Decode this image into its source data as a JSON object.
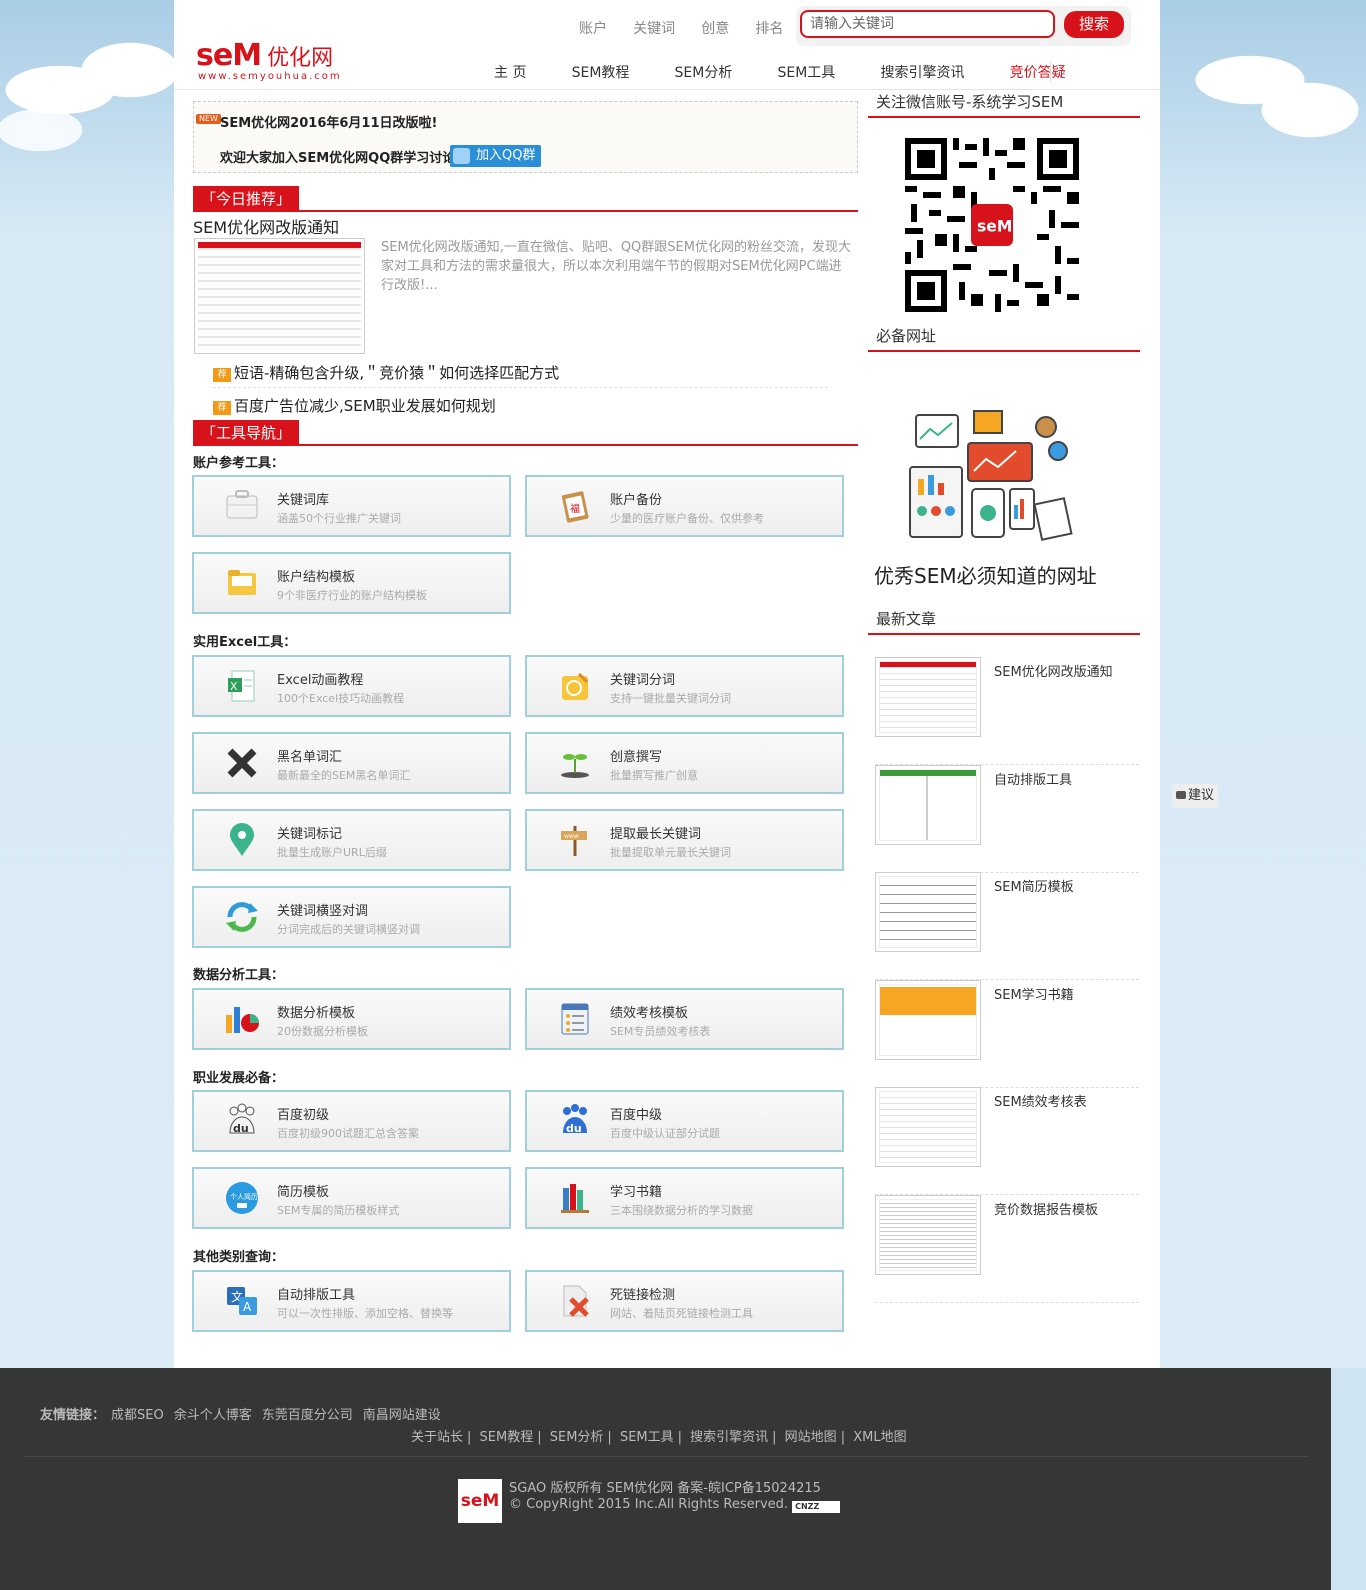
{
  "header": {
    "logo_text": "seM",
    "logo_cn": "优化网",
    "logo_url": "www.semyouhua.com",
    "top_links": [
      "账户",
      "关键词",
      "创意",
      "排名"
    ],
    "search_placeholder": "请输入关键词",
    "search_button": "搜索",
    "nav": [
      "主 页",
      "SEM教程",
      "SEM分析",
      "SEM工具",
      "搜索引擎资讯",
      "竞价答疑"
    ]
  },
  "notice": {
    "badge": "NEW",
    "title": "SEM优化网2016年6月11日改版啦!",
    "subtitle": "欢迎大家加入SEM优化网QQ群学习讨论",
    "qq_button": "加入QQ群"
  },
  "today": {
    "heading": "「今日推荐」",
    "title": "SEM优化网改版通知",
    "desc": "SEM优化网改版通知,一直在微信、贴吧、QQ群跟SEM优化网的粉丝交流，发现大家对工具和方法的需求量很大，所以本次利用端午节的假期对SEM优化网PC端进行改版!...",
    "items": [
      {
        "tag": "荐",
        "text": "短语-精确包含升级,＂竞价猿＂如何选择匹配方式"
      },
      {
        "tag": "荐",
        "text": "百度广告位减少,SEM职业发展如何规划"
      }
    ]
  },
  "tools": {
    "heading": "「工具导航」",
    "groups": [
      {
        "label": "账户参考工具：",
        "items": [
          {
            "icon": "briefcase-icon",
            "name": "关键词库",
            "desc": "涵盖50个行业推广关键词"
          },
          {
            "icon": "clipboard-icon",
            "name": "账户备份",
            "desc": "少量的医疗账户备份、仅供参考"
          },
          {
            "icon": "folder-icon",
            "name": "账户结构模板",
            "desc": "9个非医疗行业的账户结构模板"
          }
        ]
      },
      {
        "label": "实用Excel工具：",
        "items": [
          {
            "icon": "spreadsheet-icon",
            "name": "Excel动画教程",
            "desc": "100个Excel技巧动画教程"
          },
          {
            "icon": "notepad-icon",
            "name": "关键词分词",
            "desc": "支持一键批量关键词分词"
          },
          {
            "icon": "x-mark-icon",
            "name": "黑名单词汇",
            "desc": "最新最全的SEM黑名单词汇"
          },
          {
            "icon": "sprout-icon",
            "name": "创意撰写",
            "desc": "批量撰写推广创意"
          },
          {
            "icon": "map-pin-icon",
            "name": "关键词标记",
            "desc": "批量生成账户URL后缀"
          },
          {
            "icon": "signpost-icon",
            "name": "提取最长关键词",
            "desc": "批量提取单元最长关键词"
          },
          {
            "icon": "refresh-icon",
            "name": "关键词横竖对调",
            "desc": "分词完成后的关键词横竖对调"
          }
        ]
      },
      {
        "label": "数据分析工具：",
        "items": [
          {
            "icon": "chart-icon",
            "name": "数据分析模板",
            "desc": "20份数据分析模板"
          },
          {
            "icon": "list-icon",
            "name": "绩效考核模板",
            "desc": "SEM专员绩效考核表"
          }
        ]
      },
      {
        "label": "职业发展必备：",
        "items": [
          {
            "icon": "baidu-icon",
            "name": "百度初级",
            "desc": "百度初级900试题汇总含答案"
          },
          {
            "icon": "baidu-icon",
            "name": "百度中级",
            "desc": "百度中级认证部分试题"
          },
          {
            "icon": "resume-icon",
            "name": "简历模板",
            "desc": "SEM专属的简历模板样式"
          },
          {
            "icon": "books-icon",
            "name": "学习书籍",
            "desc": "三本围绕数据分析的学习数据"
          }
        ]
      },
      {
        "label": "其他类别查询：",
        "items": [
          {
            "icon": "translate-icon",
            "name": "自动排版工具",
            "desc": "可以一次性排版、添加空格、替换等"
          },
          {
            "icon": "broken-file-icon",
            "name": "死链接检测",
            "desc": "网站、着陆页死链接检测工具"
          }
        ]
      }
    ]
  },
  "sidebar": {
    "wechat_heading": "关注微信账号-系统学习SEM",
    "qr_center": "seM",
    "sites_heading": "必备网址",
    "sites_title": "优秀SEM必须知道的网址",
    "latest_heading": "最新文章",
    "articles": [
      "SEM优化网改版通知",
      "自动排版工具",
      "SEM简历模板",
      "SEM学习书籍",
      "SEM绩效考核表",
      "竞价数据报告模板"
    ]
  },
  "suggest": "建议",
  "footer": {
    "friend_label": "友情链接：",
    "friends": [
      "成都SEO",
      "余斗个人博客",
      "东莞百度分公司",
      "南昌网站建设"
    ],
    "nav": [
      "关于站长",
      "SEM教程",
      "SEM分析",
      "SEM工具",
      "搜索引擎资讯",
      "网站地图",
      "XML地图"
    ],
    "copyright1": "SGAO 版权所有 SEM优化网 备案-皖ICP备15024215",
    "copyright2": "© CopyRight 2015 Inc.All Rights Reserved.",
    "cnzz": "CNZZ",
    "logo_text": "seM"
  },
  "colors": {
    "brand": "#d7121b",
    "card_border": "#9fd0dc",
    "footer_bg": "#363636"
  }
}
